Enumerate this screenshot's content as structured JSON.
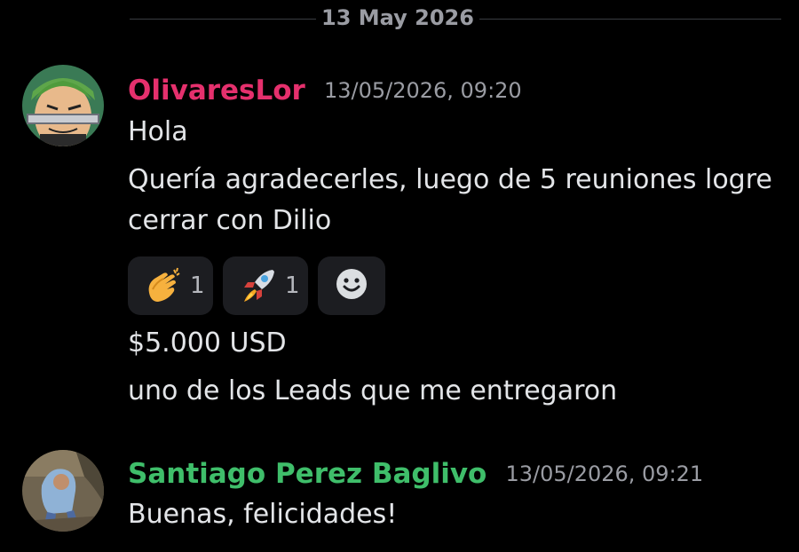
{
  "date_divider": "13 May 2026",
  "messages": [
    {
      "author": "OlivaresLor",
      "author_color": "#e5306d",
      "timestamp": "13/05/2026, 09:20",
      "lines": [
        "Hola",
        "Quería agradecerles, luego de 5 reuniones logre",
        "cerrar con Dilio"
      ],
      "reactions": [
        {
          "emoji": "clapping-hands",
          "count": "1"
        },
        {
          "emoji": "rocket",
          "count": "1"
        }
      ],
      "after_lines": [
        "$5.000 USD",
        "uno de los Leads que me entregaron"
      ]
    },
    {
      "author": "Santiago Perez Baglivo",
      "author_color": "#3fbe6a",
      "timestamp": "13/05/2026, 09:21",
      "lines": [
        "Buenas, felicidades!"
      ]
    }
  ]
}
